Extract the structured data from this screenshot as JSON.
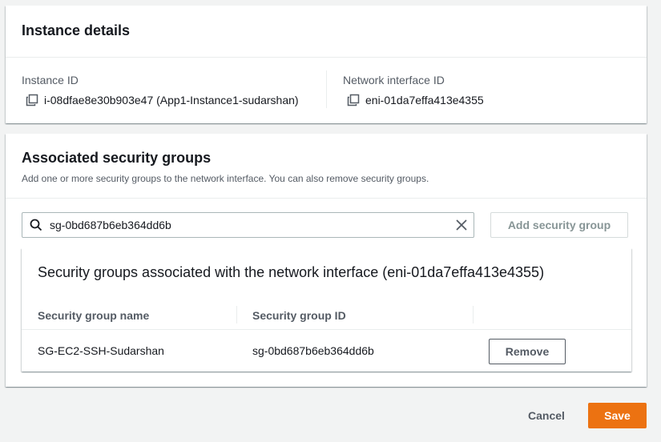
{
  "instance_details": {
    "title": "Instance details",
    "instance_id_label": "Instance ID",
    "instance_id_value": "i-08dfae8e30b903e47 (App1-Instance1-sudarshan)",
    "network_interface_label": "Network interface ID",
    "network_interface_value": "eni-01da7effa413e4355",
    "copy_icon": "copy-icon"
  },
  "security_groups": {
    "title": "Associated security groups",
    "description": "Add one or more security groups to the network interface. You can also remove security groups.",
    "search": {
      "value": "sg-0bd687b6eb364dd6b",
      "icon": "search-icon",
      "clear_icon": "close-icon"
    },
    "add_button_label": "Add security group",
    "table": {
      "title": "Security groups associated with the network interface (eni-01da7effa413e4355)",
      "columns": [
        "Security group name",
        "Security group ID"
      ],
      "rows": [
        {
          "name": "SG-EC2-SSH-Sudarshan",
          "id": "sg-0bd687b6eb364dd6b",
          "action": "Remove"
        }
      ]
    }
  },
  "footer": {
    "cancel_label": "Cancel",
    "save_label": "Save"
  },
  "colors": {
    "primary": "#ec7211",
    "background": "#f2f3f3",
    "border": "#aab7b8"
  }
}
